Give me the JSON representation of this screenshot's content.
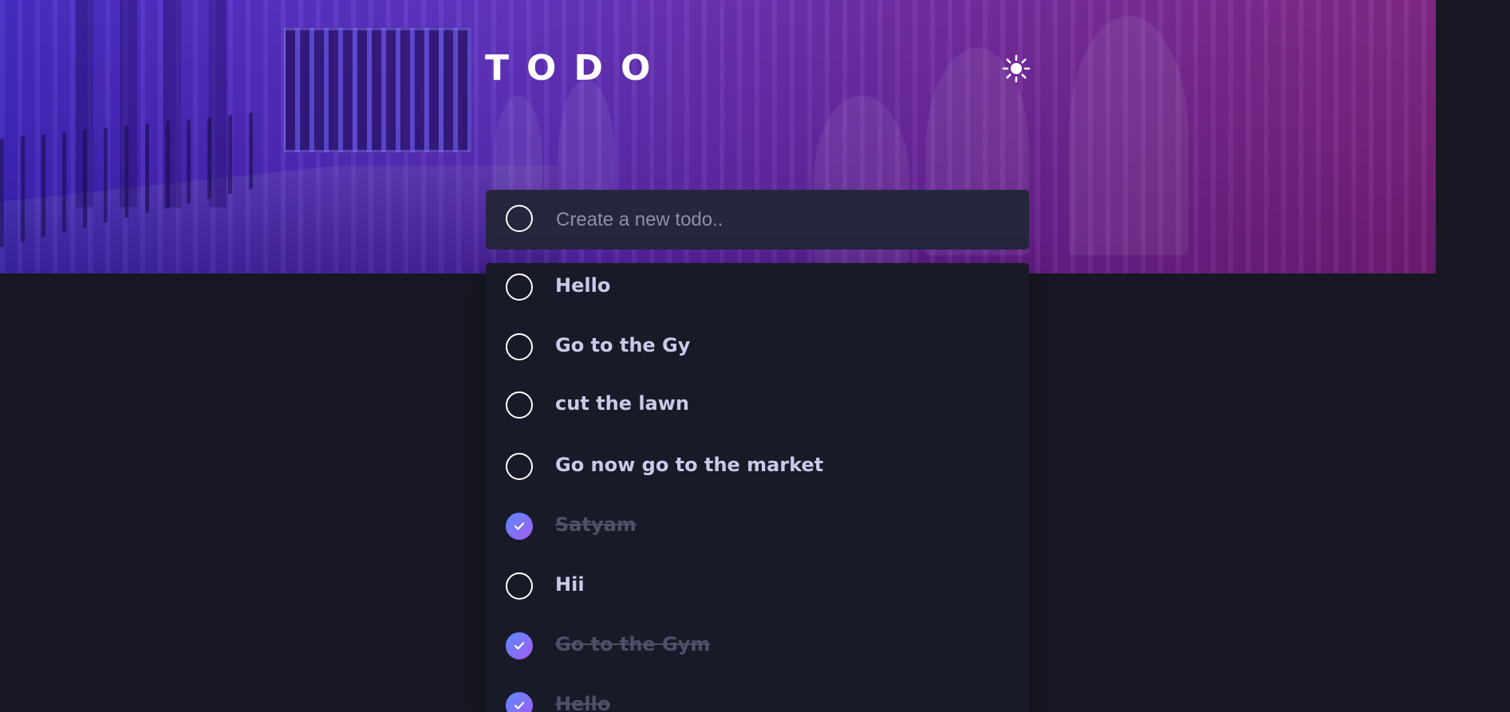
{
  "header": {
    "title": "TODO",
    "theme_toggle_icon": "sun-icon"
  },
  "new_todo": {
    "placeholder": "Create a new todo.."
  },
  "todos": [
    {
      "text": "Hello",
      "completed": false
    },
    {
      "text": "Go to the Gy",
      "completed": false
    },
    {
      "text": "cut the lawn",
      "completed": false
    },
    {
      "text": "Go now go to the market",
      "completed": false
    },
    {
      "text": "Satyam",
      "completed": true
    },
    {
      "text": "Hii",
      "completed": false
    },
    {
      "text": "Go to the Gym",
      "completed": true
    },
    {
      "text": "Hello",
      "completed": true
    }
  ],
  "colors": {
    "background": "#171823",
    "card": "#25273d",
    "text": "#c8cbe7",
    "completed_text": "#4d5067",
    "check_gradient_start": "#5a8bff",
    "check_gradient_end": "#a35bf0"
  }
}
